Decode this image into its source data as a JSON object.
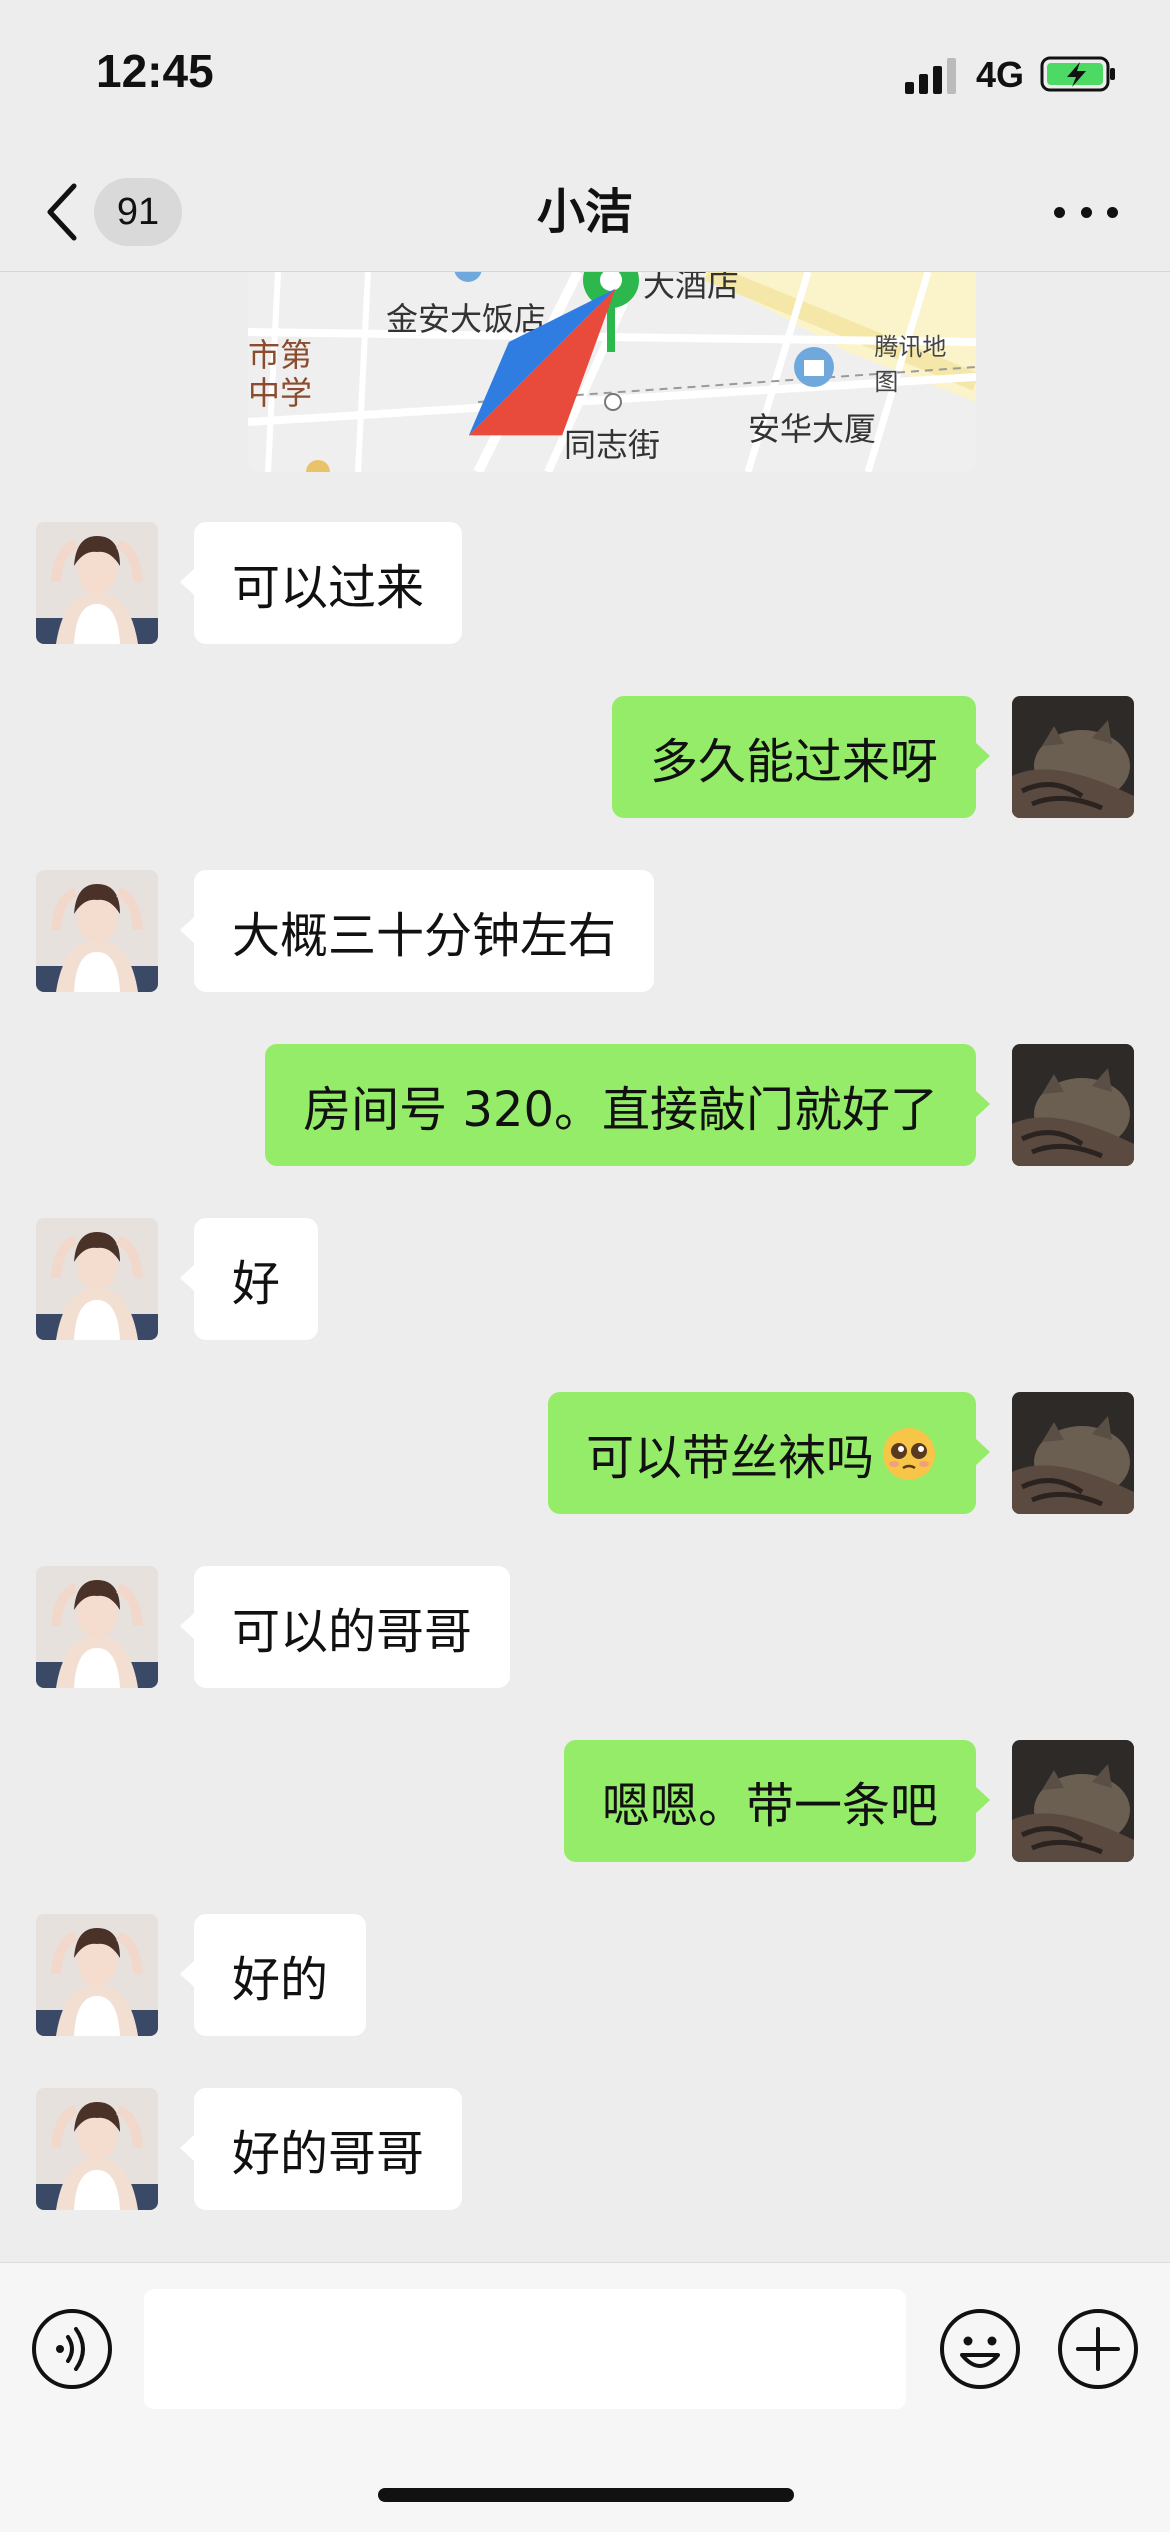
{
  "status_bar": {
    "time": "12:45",
    "network": "4G"
  },
  "nav": {
    "unread_count": "91",
    "title": "小洁"
  },
  "map": {
    "labels": [
      "金安大饭店",
      "大酒店",
      "同志街",
      "安华大厦",
      "市第",
      "中学"
    ],
    "brand": "腾讯地图"
  },
  "messages": [
    {
      "side": "left",
      "text": "可以过来"
    },
    {
      "side": "right",
      "text": "多久能过来呀"
    },
    {
      "side": "left",
      "text": "大概三十分钟左右"
    },
    {
      "side": "right",
      "text": "房间号 320。直接敲门就好了"
    },
    {
      "side": "left",
      "text": "好"
    },
    {
      "side": "right",
      "text": "可以带丝袜吗",
      "emoji": "pleading-face-icon"
    },
    {
      "side": "left",
      "text": "可以的哥哥"
    },
    {
      "side": "right",
      "text": "嗯嗯。带一条吧"
    },
    {
      "side": "left",
      "text": "好的"
    },
    {
      "side": "left",
      "text": "好的哥哥"
    }
  ],
  "input": {
    "value": "",
    "placeholder": ""
  },
  "colors": {
    "background": "#ededed",
    "self_bubble": "#95ec69",
    "other_bubble": "#ffffff",
    "battery": "#4cd964"
  }
}
